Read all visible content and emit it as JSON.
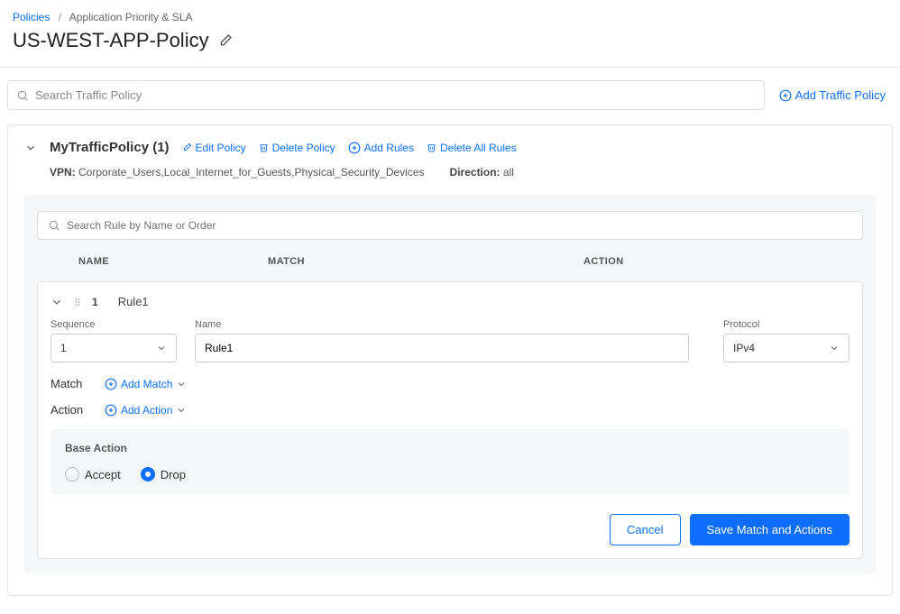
{
  "breadcrumb": {
    "root": "Policies",
    "current": "Application Priority & SLA"
  },
  "page_title": "US-WEST-APP-Policy",
  "search": {
    "placeholder": "Search Traffic Policy"
  },
  "add_policy_label": "Add Traffic Policy",
  "policy": {
    "display_name": "MyTrafficPolicy (1)",
    "actions": {
      "edit": "Edit Policy",
      "delete": "Delete Policy",
      "add_rules": "Add Rules",
      "delete_all_rules": "Delete All Rules"
    },
    "meta": {
      "vpn_label": "VPN:",
      "vpn_value": "Corporate_Users,Local_Internet_for_Guests,Physical_Security_Devices",
      "direction_label": "Direction:",
      "direction_value": "all"
    }
  },
  "rule_search": {
    "placeholder": "Search Rule by Name or Order"
  },
  "columns": {
    "name": "NAME",
    "match": "MATCH",
    "action": "ACTION"
  },
  "rule": {
    "order": "1",
    "title": "Rule1",
    "fields": {
      "sequence": {
        "label": "Sequence",
        "value": "1"
      },
      "name": {
        "label": "Name",
        "value": "Rule1"
      },
      "protocol": {
        "label": "Protocol",
        "value": "IPv4"
      }
    },
    "match_section": {
      "label": "Match",
      "add": "Add Match"
    },
    "action_section": {
      "label": "Action",
      "add": "Add Action"
    },
    "base_action": {
      "title": "Base Action",
      "options": {
        "accept": "Accept",
        "drop": "Drop"
      }
    },
    "buttons": {
      "cancel": "Cancel",
      "save": "Save Match and Actions"
    }
  }
}
